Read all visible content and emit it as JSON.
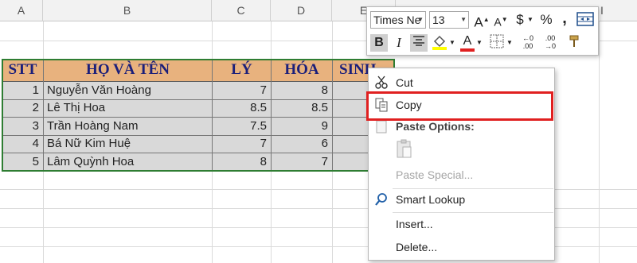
{
  "columns": [
    "A",
    "B",
    "C",
    "D",
    "E",
    "I"
  ],
  "table": {
    "headers": [
      "STT",
      "HỌ VÀ TÊN",
      "LÝ",
      "HÓA",
      "SINH"
    ],
    "rows": [
      {
        "stt": "1",
        "name": "Nguyễn Văn Hoàng",
        "ly": "7",
        "hoa": "8"
      },
      {
        "stt": "2",
        "name": "Lê Thị Hoa",
        "ly": "8.5",
        "hoa": "8.5"
      },
      {
        "stt": "3",
        "name": "Trần Hoàng Nam",
        "ly": "7.5",
        "hoa": "9"
      },
      {
        "stt": "4",
        "name": "Bá Nữ Kim Huệ",
        "ly": "7",
        "hoa": "6"
      },
      {
        "stt": "5",
        "name": "Lâm Quỳnh Hoa",
        "ly": "8",
        "hoa": "7"
      }
    ],
    "header_color": "#e8b27e",
    "header_text_color": "#1b1f7a",
    "selection_fill": "#d9d9d9",
    "border_color": "#2e7d32"
  },
  "toolbar": {
    "font_name": "Times Ne",
    "font_size": "13",
    "grow_font": "A",
    "shrink_font": "A",
    "currency": "$",
    "percent": "%",
    "comma": ",",
    "bold": "B",
    "italic": "I",
    "font_color_letter": "A",
    "inc_decimal": "←0 .00",
    "dec_decimal": ".00 →0",
    "font_color": "#e02020",
    "fill_color": "#ffff00"
  },
  "menu": {
    "cut": "Cut",
    "copy": "Copy",
    "paste_options": "Paste Options:",
    "paste_special": "Paste Special...",
    "smart_lookup": "Smart Lookup",
    "insert": "Insert...",
    "delete": "Delete...",
    "highlight_color": "#e02020"
  }
}
